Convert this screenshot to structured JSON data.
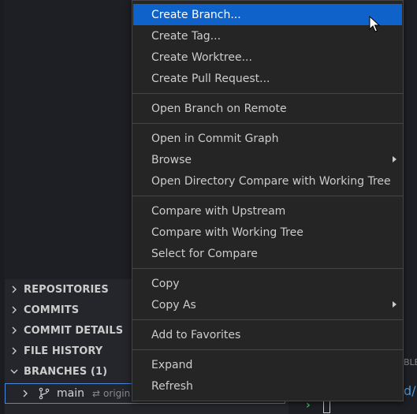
{
  "sidebar": {
    "sections": [
      {
        "label": "REPOSITORIES",
        "expanded": false
      },
      {
        "label": "COMMITS",
        "expanded": false
      },
      {
        "label": "COMMIT DETAILS",
        "expanded": false
      },
      {
        "label": "FILE HISTORY",
        "expanded": false
      },
      {
        "label": "BRANCHES (1)",
        "expanded": true
      }
    ],
    "branch_row": {
      "name": "main",
      "sync_icon": "⇄",
      "remote": "origin"
    }
  },
  "editor": {
    "panel_label": "BLE",
    "terminal_path": "d/",
    "terminal_prompt": "›"
  },
  "context_menu": {
    "groups": [
      [
        "Create Branch...",
        "Create Tag...",
        "Create Worktree...",
        "Create Pull Request..."
      ],
      [
        "Open Branch on Remote"
      ],
      [
        "Open in Commit Graph",
        "Browse",
        "Open Directory Compare with Working Tree"
      ],
      [
        "Compare with Upstream",
        "Compare with Working Tree",
        "Select for Compare"
      ],
      [
        "Copy",
        "Copy As"
      ],
      [
        "Add to Favorites"
      ],
      [
        "Expand",
        "Refresh"
      ]
    ],
    "highlighted": "Create Branch...",
    "submenus": [
      "Browse",
      "Copy As"
    ]
  },
  "colors": {
    "menu_highlight": "#0e62c9",
    "focus_border": "#4a88d8",
    "terminal_prompt": "#3ec55a",
    "terminal_path": "#4a9ae0"
  }
}
